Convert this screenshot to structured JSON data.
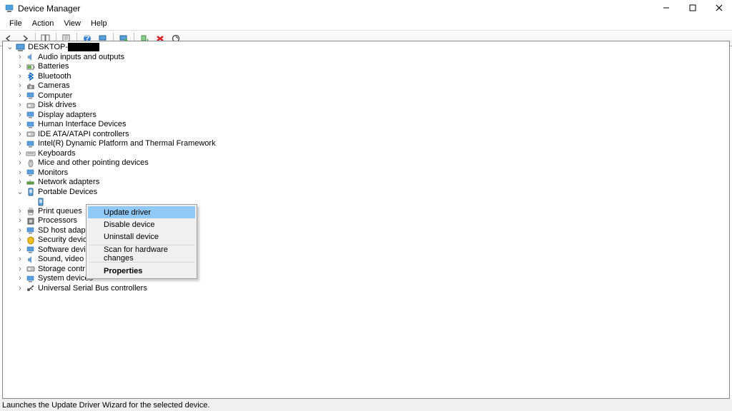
{
  "window": {
    "title": "Device Manager"
  },
  "menu": {
    "file": "File",
    "action": "Action",
    "view": "View",
    "help": "Help"
  },
  "tree": {
    "root": "DESKTOP-",
    "items": [
      "Audio inputs and outputs",
      "Batteries",
      "Bluetooth",
      "Cameras",
      "Computer",
      "Disk drives",
      "Display adapters",
      "Human Interface Devices",
      "IDE ATA/ATAPI controllers",
      "Intel(R) Dynamic Platform and Thermal Framework",
      "Keyboards",
      "Mice and other pointing devices",
      "Monitors",
      "Network adapters",
      "Portable Devices",
      "",
      "Print queues",
      "Processors",
      "SD host adapt",
      "Security devic",
      "Software devi",
      "Sound, video",
      "Storage contr",
      "System devices",
      "Universal Serial Bus controllers"
    ]
  },
  "context_menu": {
    "update_driver": "Update driver",
    "disable_device": "Disable device",
    "uninstall_device": "Uninstall device",
    "scan_hardware": "Scan for hardware changes",
    "properties": "Properties"
  },
  "statusbar": "Launches the Update Driver Wizard for the selected device."
}
